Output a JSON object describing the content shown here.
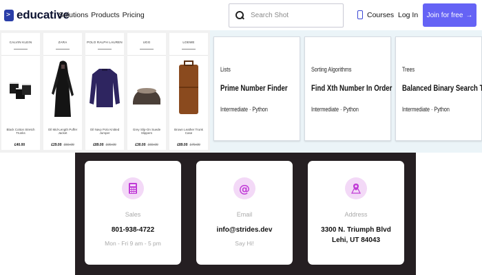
{
  "header": {
    "logo_text": "educative",
    "nav": [
      "Solutions",
      "Products",
      "Pricing"
    ],
    "search_placeholder": "Search Shot",
    "courses_label": "Courses",
    "login_label": "Log In",
    "join_label": "Join for free",
    "join_arrow": "→",
    "accent_color": "#6563f5"
  },
  "products": [
    {
      "tag": "CALVIN KLEIN",
      "name": "Black Cotton Stretch Trunks",
      "price": "£40.00",
      "old_price": ""
    },
    {
      "tag": "ZARA",
      "name": "Oil Mid-Length Puffer Jacket",
      "price": "£29.00",
      "old_price": "£59.00"
    },
    {
      "tag": "POLO RALPH LAUREN",
      "name": "Oil Navy Polo Knitted Jumper",
      "price": "£89.00",
      "old_price": "£99.00"
    },
    {
      "tag": "UGG",
      "name": "Grey Slip-On Suede Slippers",
      "price": "£30.00",
      "old_price": "£69.00"
    },
    {
      "tag": "LOEWE",
      "name": "Brown Leather Trunk Case",
      "price": "£89.00",
      "old_price": "£79.00"
    }
  ],
  "shots": [
    {
      "category": "Lists",
      "title": "Prime Number Finder",
      "meta": "Intermediate · Python"
    },
    {
      "category": "Sorting Algorithms",
      "title": "Find Xth Number In Order",
      "meta": "Intermediate · Python"
    },
    {
      "category": "Trees",
      "title": "Balanced Binary Search Tree",
      "meta": "Intermediate · Python"
    }
  ],
  "contact": [
    {
      "icon": "calculator-icon",
      "label": "Sales",
      "value": "801-938-4722",
      "value2": "",
      "sub": "Mon - Fri 9 am - 5 pm"
    },
    {
      "icon": "at-sign-icon",
      "label": "Email",
      "value": "info@strides.dev",
      "value2": "",
      "sub": "Say Hi!"
    },
    {
      "icon": "map-pin-icon",
      "label": "Address",
      "value": "3300 N. Triumph Blvd",
      "value2": "Lehi, UT 84043",
      "sub": ""
    }
  ],
  "colors": {
    "icon_purple": "#c03bd6",
    "icon_bg": "#f3d9f7",
    "dark_bg": "#251f22"
  }
}
